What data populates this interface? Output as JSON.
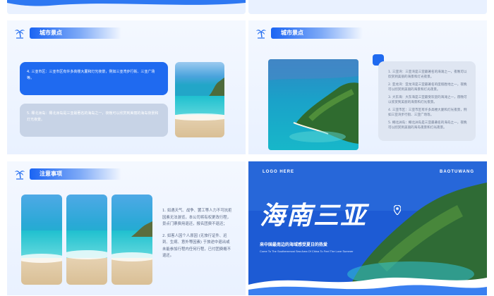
{
  "slides": {
    "city_left": {
      "section_title": "城市景点",
      "card_blue_text": "4. 三亚市区：三亚市区有许多高楼大厦和灯光夜景，例如三亚湾步行街、三亚广场等。",
      "card_grey_text": "5. 椰北洲岛：椰北洲岛是三亚最著名的海岛之一，夜晚可以欣赏到美丽的海岛夜景和灯光夜景。"
    },
    "city_right": {
      "section_title": "城市景点",
      "list_items": [
        "1. 三亚湾：三亚湾是三亚最著名的海滩之一，夜晚可以欣赏到美丽的海景和灯光夜景。",
        "2. 亚龙湾：亚龙湾是三亚最著名的度假胜地之一，夜晚可以欣赏到美丽的海景和灯光夜景。",
        "3. 大东海：大东海是三亚最受欢迎的海滩之一，夜晚可以欣赏到美丽的海景和灯光夜景。",
        "4. 三亚市区：三亚市区有许多高楼大厦和灯光夜景，例如三亚湾步行街、三亚广场等。",
        "5. 椰北洲岛：椰北洲岛是三亚最著名的海岛之一，夜晚可以欣赏到美丽的海岛夜景和灯光夜景。"
      ]
    },
    "notes": {
      "section_title": "注意事项",
      "items": [
        "1. 如遇天气、战争、罢工等人力不可抗拒因素无法游览，本公司将有权更改行程，景点门票费用退还，报名团费不退还；",
        "2. 如客人因个人原因 (无旅行证件、迟到、生病、意外等因素) 于旅途中退出或未能参加行程内任何行程，已付团费概不退还。"
      ]
    },
    "cover": {
      "logo_text": "LOGO HERE",
      "brand_text": "BAOTUWANG",
      "title": "海南三亚",
      "subtitle": "来中国最南边的海域感受夏日的热爱",
      "subtitle_en": "Come To The Southernmost Sea Area Of China To Feel The Love Summer"
    }
  },
  "colors": {
    "accent": "#1f6af0",
    "card_grey": "#c7d3e6",
    "cover_bg": "#1c4fcf"
  }
}
